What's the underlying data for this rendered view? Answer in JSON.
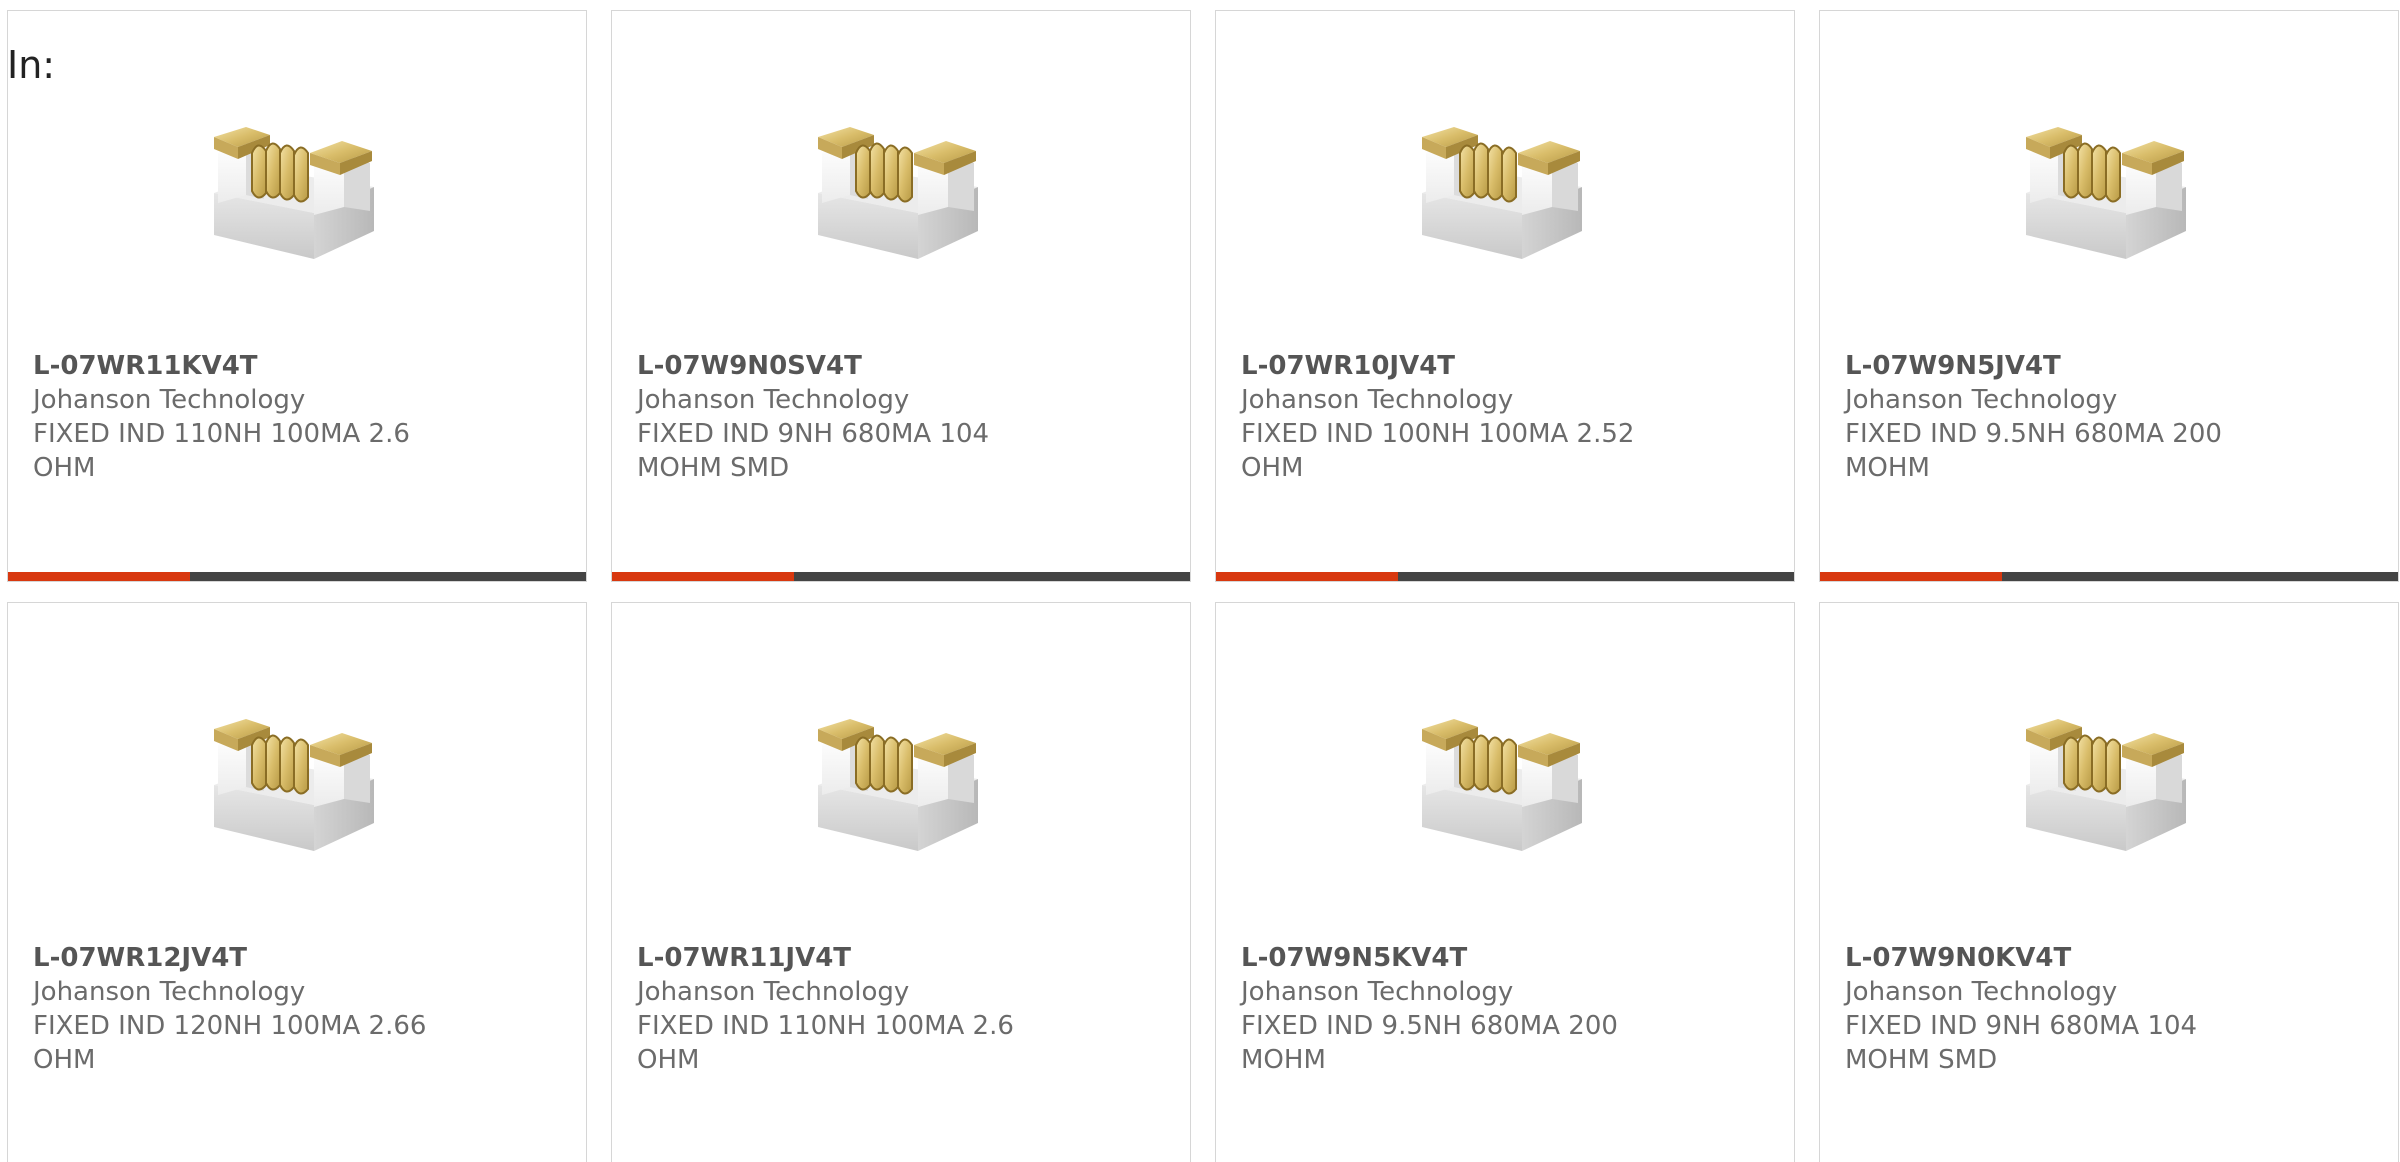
{
  "filter_label": "In:",
  "accent_color": "#d8380f",
  "bar_color": "#444444",
  "products": [
    {
      "part": "L-07WR11KV4T",
      "maker": "Johanson Technology",
      "desc": "FIXED IND 110NH 100MA 2.6 OHM",
      "image": "smd-inductor-chip-icon"
    },
    {
      "part": "L-07W9N0SV4T",
      "maker": "Johanson Technology",
      "desc": "FIXED IND 9NH 680MA 104 MOHM SMD",
      "image": "smd-inductor-chip-icon"
    },
    {
      "part": "L-07WR10JV4T",
      "maker": "Johanson Technology",
      "desc": "FIXED IND 100NH 100MA 2.52 OHM",
      "image": "smd-inductor-chip-icon"
    },
    {
      "part": "L-07W9N5JV4T",
      "maker": "Johanson Technology",
      "desc": "FIXED IND 9.5NH 680MA 200 MOHM",
      "image": "smd-inductor-chip-icon"
    },
    {
      "part": "L-07WR12JV4T",
      "maker": "Johanson Technology",
      "desc": "FIXED IND 120NH 100MA 2.66 OHM",
      "image": "smd-inductor-chip-icon"
    },
    {
      "part": "L-07WR11JV4T",
      "maker": "Johanson Technology",
      "desc": "FIXED IND 110NH 100MA 2.6 OHM",
      "image": "smd-inductor-chip-icon"
    },
    {
      "part": "L-07W9N5KV4T",
      "maker": "Johanson Technology",
      "desc": "FIXED IND 9.5NH 680MA 200 MOHM",
      "image": "smd-inductor-chip-icon"
    },
    {
      "part": "L-07W9N0KV4T",
      "maker": "Johanson Technology",
      "desc": "FIXED IND 9NH 680MA 104 MOHM SMD",
      "image": "smd-inductor-chip-icon"
    }
  ]
}
